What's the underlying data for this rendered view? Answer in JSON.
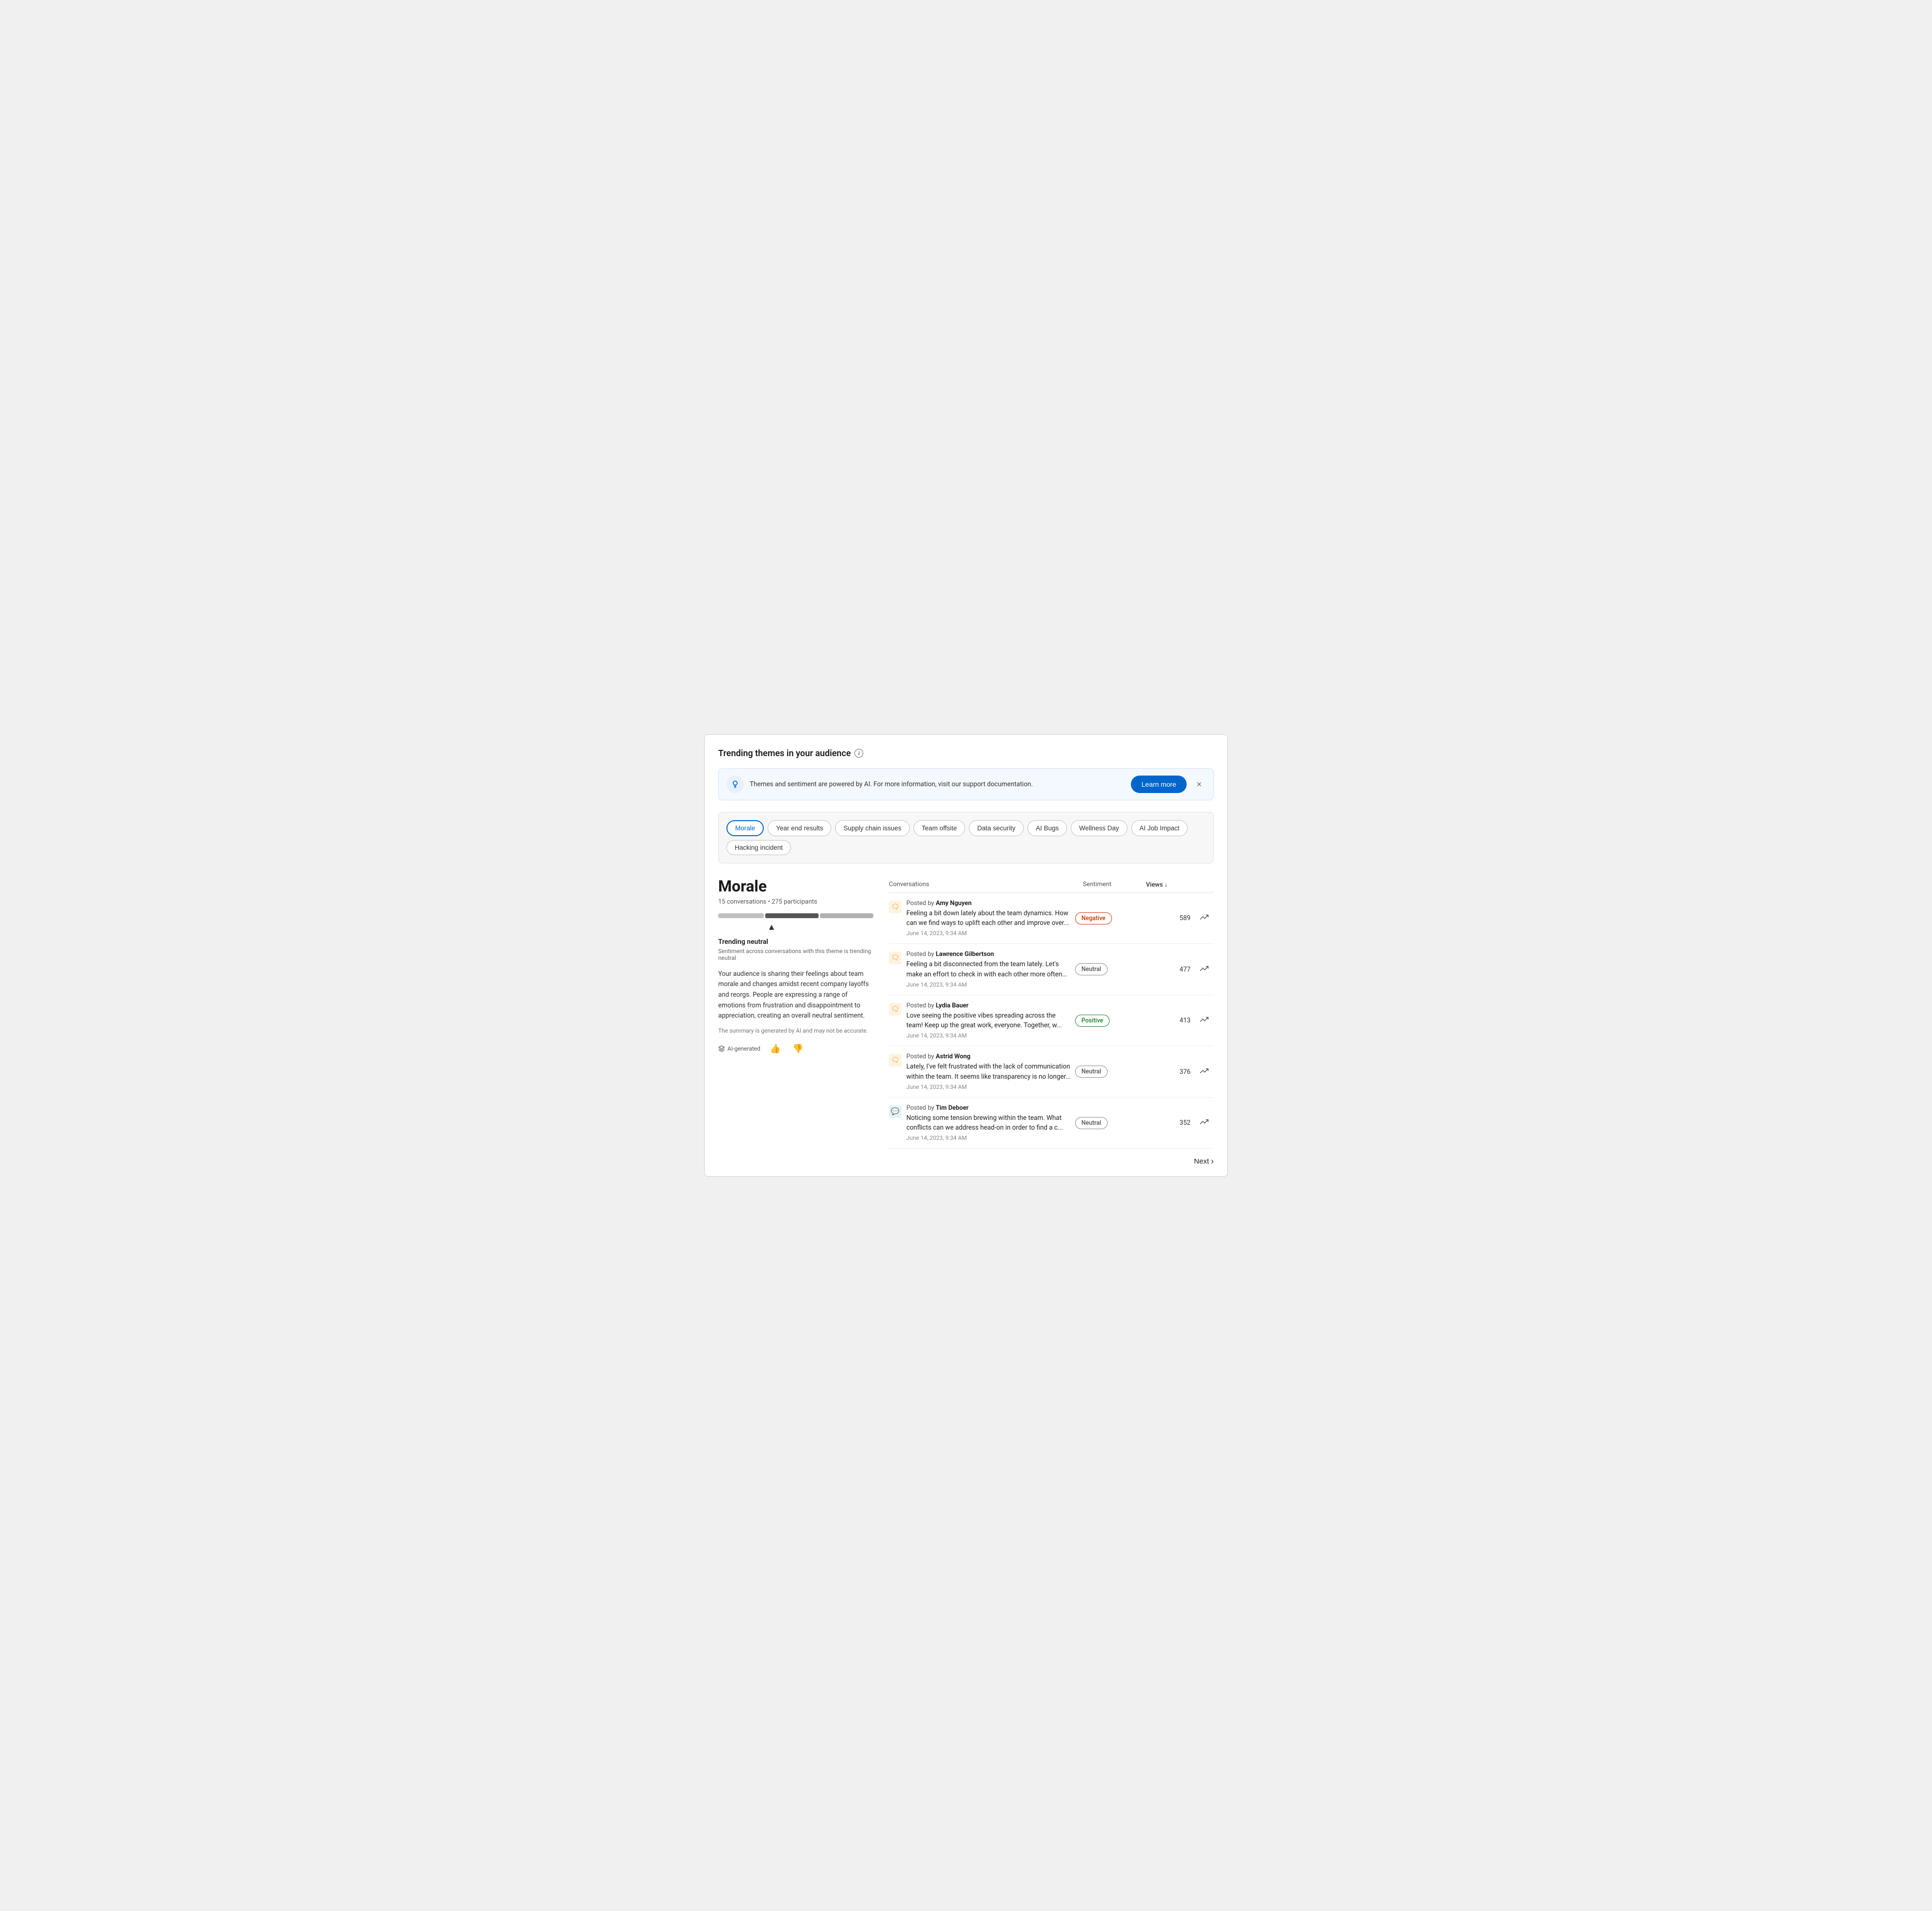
{
  "page": {
    "title": "Trending themes in your audience"
  },
  "banner": {
    "text": "Themes and sentiment are powered by AI. For more information, visit our support documentation.",
    "learn_more_label": "Learn more"
  },
  "tags": [
    {
      "id": "morale",
      "label": "Morale",
      "active": true
    },
    {
      "id": "year-end",
      "label": "Year end results",
      "active": false
    },
    {
      "id": "supply-chain",
      "label": "Supply chain issues",
      "active": false
    },
    {
      "id": "team-offsite",
      "label": "Team offsite",
      "active": false
    },
    {
      "id": "data-security",
      "label": "Data security",
      "active": false
    },
    {
      "id": "ai-bugs",
      "label": "AI Bugs",
      "active": false
    },
    {
      "id": "wellness-day",
      "label": "Wellness Day",
      "active": false
    },
    {
      "id": "ai-job-impact",
      "label": "AI Job Impact",
      "active": false
    },
    {
      "id": "hacking-incident",
      "label": "Hacking incident",
      "active": false
    }
  ],
  "theme": {
    "title": "Morale",
    "conversations_count": "15 conversations",
    "participants_count": "275 participants",
    "trending_label": "Trending neutral",
    "trending_sublabel": "Sentiment across conversations with this theme is trending neutral",
    "description": "Your audience is sharing their feelings about team morale and changes amidst recent company layoffs and reorgs. People are expressing a range of emotions from frustration and disappointment to appreciation, creating an overall neutral sentiment.",
    "disclaimer": "The summary is generated by AI and may not be accurate.",
    "ai_badge_label": "AI-generated"
  },
  "table": {
    "col_conversations": "Conversations",
    "col_sentiment": "Sentiment",
    "col_views": "Views",
    "conversations": [
      {
        "author": "Amy Nguyen",
        "text": "Feeling a bit down lately about the team dynamics. How can we find ways to uplift each other and improve over...",
        "date": "June 14, 2023, 9:34 AM",
        "sentiment": "Negative",
        "sentiment_type": "negative",
        "views": "589",
        "icon_type": "orange"
      },
      {
        "author": "Lawrence Gilbertson",
        "text": "Feeling a bit disconnected from the team lately. Let's make an effort to check in with each other more often...",
        "date": "June 14, 2023, 9:34 AM",
        "sentiment": "Neutral",
        "sentiment_type": "neutral",
        "views": "477",
        "icon_type": "orange"
      },
      {
        "author": "Lydia Bauer",
        "text": "Love seeing the positive vibes spreading across the team! Keep up the great work, everyone. Together, w...",
        "date": "June 14, 2023, 9:34 AM",
        "sentiment": "Positive",
        "sentiment_type": "positive",
        "views": "413",
        "icon_type": "orange"
      },
      {
        "author": "Astrid Wong",
        "text": "Lately, I've felt frustrated with the lack of communication within the team. It seems like transparency is no longer...",
        "date": "June 14, 2023, 9:34 AM",
        "sentiment": "Neutral",
        "sentiment_type": "neutral",
        "views": "376",
        "icon_type": "orange"
      },
      {
        "author": "Tim Deboer",
        "text": "Noticing some tension brewing within the team. What conflicts can we address head-on in order to find a c...",
        "date": "June 14, 2023, 9:34 AM",
        "sentiment": "Neutral",
        "sentiment_type": "neutral",
        "views": "352",
        "icon_type": "blue"
      }
    ]
  },
  "pagination": {
    "next_label": "Next"
  }
}
